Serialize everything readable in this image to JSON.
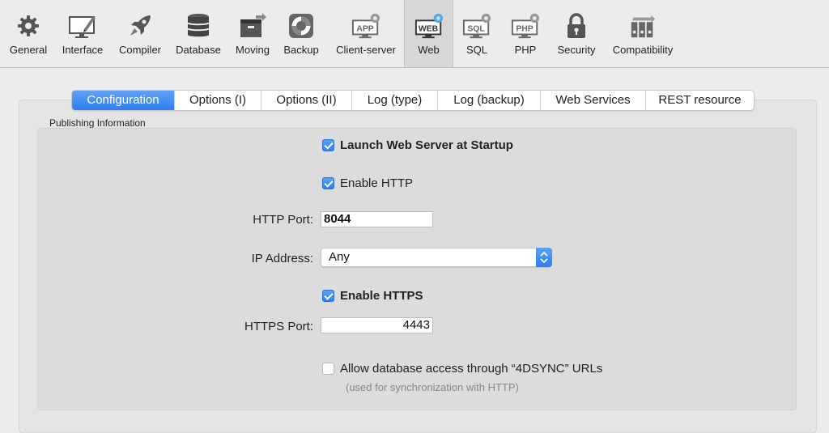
{
  "toolbar": {
    "items": [
      {
        "label": "General",
        "icon": "gear-icon"
      },
      {
        "label": "Interface",
        "icon": "interface-icon"
      },
      {
        "label": "Compiler",
        "icon": "rocket-icon"
      },
      {
        "label": "Database",
        "icon": "database-icon"
      },
      {
        "label": "Moving",
        "icon": "moving-box-icon"
      },
      {
        "label": "Backup",
        "icon": "lifebuoy-icon"
      },
      {
        "label": "Client-server",
        "icon": "app-server-icon"
      },
      {
        "label": "Web",
        "icon": "web-icon"
      },
      {
        "label": "SQL",
        "icon": "sql-icon"
      },
      {
        "label": "PHP",
        "icon": "php-icon"
      },
      {
        "label": "Security",
        "icon": "lock-icon"
      },
      {
        "label": "Compatibility",
        "icon": "compatibility-icon"
      }
    ],
    "selected": "Web",
    "icon_badges": {
      "APP": "APP",
      "WEB": "WEB",
      "SQL": "SQL",
      "PHP": "PHP"
    }
  },
  "tabs": [
    {
      "label": "Configuration"
    },
    {
      "label": "Options (I)"
    },
    {
      "label": "Options (II)"
    },
    {
      "label": "Log (type)"
    },
    {
      "label": "Log (backup)"
    },
    {
      "label": "Web Services"
    },
    {
      "label": "REST resource"
    }
  ],
  "group": {
    "title": "Publishing Information"
  },
  "form": {
    "launch_at_startup": {
      "label": "Launch Web Server at Startup",
      "checked": true
    },
    "enable_http": {
      "label": "Enable HTTP",
      "checked": true
    },
    "http_port": {
      "label": "HTTP Port:",
      "value": "8044"
    },
    "ip_address": {
      "label": "IP Address:",
      "value": "Any"
    },
    "enable_https": {
      "label": "Enable HTTPS",
      "checked": true
    },
    "https_port": {
      "label": "HTTPS Port:",
      "value": "4443"
    },
    "allow_4dsync": {
      "label": "Allow database access through “4DSYNC” URLs",
      "checked": false
    },
    "allow_4dsync_note": "(used for synchronization with HTTP)"
  },
  "colors": {
    "accent": "#2f7ff0",
    "background": "#ececec",
    "group": "#dcdcdc"
  }
}
